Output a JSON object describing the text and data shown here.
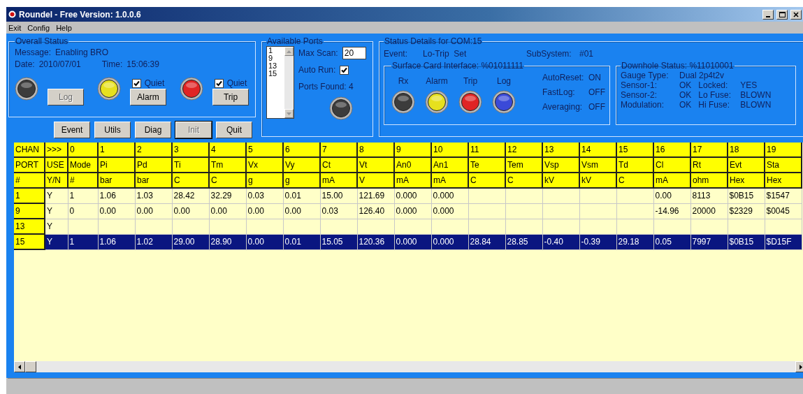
{
  "window": {
    "title": "Roundel - Free Version: 1.0.0.6"
  },
  "menu": [
    "Exit",
    "Config",
    "Help"
  ],
  "overall_status": {
    "title": "Overall Status",
    "message_label": "Message:",
    "message": "Enabling BRO",
    "date_label": "Date:",
    "date": "2010/07/01",
    "time_label": "Time:",
    "time": "15:06:39",
    "indicators": [
      {
        "color": "#3c3c3c",
        "button": "Log",
        "disabled": true
      },
      {
        "color": "#e6e01e",
        "button": "Alarm",
        "disabled": false,
        "quiet": {
          "label": "Quiet",
          "checked": true
        }
      },
      {
        "color": "#e02424",
        "button": "Trip",
        "disabled": false,
        "quiet": {
          "label": "Quiet",
          "checked": true
        }
      }
    ]
  },
  "buttons": [
    {
      "label": "Event",
      "disabled": false
    },
    {
      "label": "Utils",
      "disabled": false
    },
    {
      "label": "Diag",
      "disabled": false
    },
    {
      "label": "Init",
      "disabled": true
    },
    {
      "label": "Quit",
      "disabled": false
    }
  ],
  "available_ports": {
    "title": "Available Ports",
    "ports": [
      "1",
      "9",
      "13",
      "15"
    ],
    "max_scan_label": "Max Scan:",
    "max_scan": "20",
    "auto_run_label": "Auto Run:",
    "auto_run": true,
    "ports_found": "Ports Found: 4",
    "indicator": {
      "color": "#3c3c3c"
    }
  },
  "status_details": {
    "title": "Status Details for COM:15",
    "event_label": "Event:",
    "event": "Lo-Trip  Set",
    "subsystem_label": "SubSystem:",
    "subsystem": "#01",
    "surface_card": {
      "title": "Surface Card Interface: %01011111",
      "lights": [
        {
          "label": "Rx",
          "color": "#3c3c3c"
        },
        {
          "label": "Alarm",
          "color": "#e6e01e"
        },
        {
          "label": "Trip",
          "color": "#e02424"
        },
        {
          "label": "Log",
          "color": "#3a4ad8"
        }
      ],
      "settings": [
        {
          "label": "AutoReset:",
          "value": "ON"
        },
        {
          "label": "FastLog:",
          "value": "OFF"
        },
        {
          "label": "Averaging:",
          "value": "OFF"
        }
      ]
    },
    "downhole": {
      "title": "Downhole Status: %11010001",
      "gauge_label": "Gauge Type:",
      "gauge": "Dual 2p4t2v",
      "left": [
        {
          "label": "Sensor-1:",
          "value": "OK"
        },
        {
          "label": "Sensor-2:",
          "value": "OK"
        },
        {
          "label": "Modulation:",
          "value": "OK"
        }
      ],
      "right": [
        {
          "label": "Locked:",
          "value": "YES"
        },
        {
          "label": "Lo Fuse:",
          "value": "BLOWN"
        },
        {
          "label": "Hi Fuse:",
          "value": "BLOWN"
        }
      ]
    }
  },
  "table": {
    "header_rows": [
      [
        "CHAN",
        ">>>",
        "0",
        "1",
        "2",
        "3",
        "4",
        "5",
        "6",
        "7",
        "8",
        "9",
        "10",
        "11",
        "12",
        "13",
        "14",
        "15",
        "16",
        "17",
        "18",
        "19"
      ],
      [
        "PORT",
        "USE",
        "Mode",
        "Pi",
        "Pd",
        "Ti",
        "Tm",
        "Vx",
        "Vy",
        "Ct",
        "Vt",
        "An0",
        "An1",
        "Te",
        "Tem",
        "Vsp",
        "Vsm",
        "Td",
        "Cl",
        "Rt",
        "Evt",
        "Sta"
      ],
      [
        "#",
        "Y/N",
        "#",
        "bar",
        "bar",
        "C",
        "C",
        "g",
        "g",
        "mA",
        "V",
        "mA",
        "mA",
        "C",
        "C",
        "kV",
        "kV",
        "C",
        "mA",
        "ohm",
        "Hex",
        "Hex"
      ]
    ],
    "rows": [
      {
        "selected": false,
        "cells": [
          "1",
          "Y",
          "1",
          "1.06",
          "1.03",
          "28.42",
          "32.29",
          "0.03",
          "0.01",
          "15.00",
          "121.69",
          "0.000",
          "0.000",
          null,
          null,
          null,
          null,
          null,
          "0.00",
          "8113",
          "$0B15",
          "$1547"
        ]
      },
      {
        "selected": false,
        "cells": [
          "9",
          "Y",
          "0",
          "0.00",
          "0.00",
          "0.00",
          "0.00",
          "0.00",
          "0.00",
          "0.03",
          "126.40",
          "0.000",
          "0.000",
          null,
          null,
          null,
          null,
          null,
          "-14.96",
          "20000",
          "$2329",
          "$0045"
        ]
      },
      {
        "selected": false,
        "cells": [
          "13",
          "Y"
        ]
      },
      {
        "selected": true,
        "cells": [
          "15",
          "Y",
          "1",
          "1.06",
          "1.02",
          "29.00",
          "28.90",
          "0.00",
          "0.01",
          "15.05",
          "120.36",
          "0.000",
          "0.000",
          "28.84",
          "28.85",
          "-0.40",
          "-0.39",
          "29.18",
          "0.05",
          "7997",
          "$0B15",
          "$D15F"
        ]
      }
    ]
  }
}
